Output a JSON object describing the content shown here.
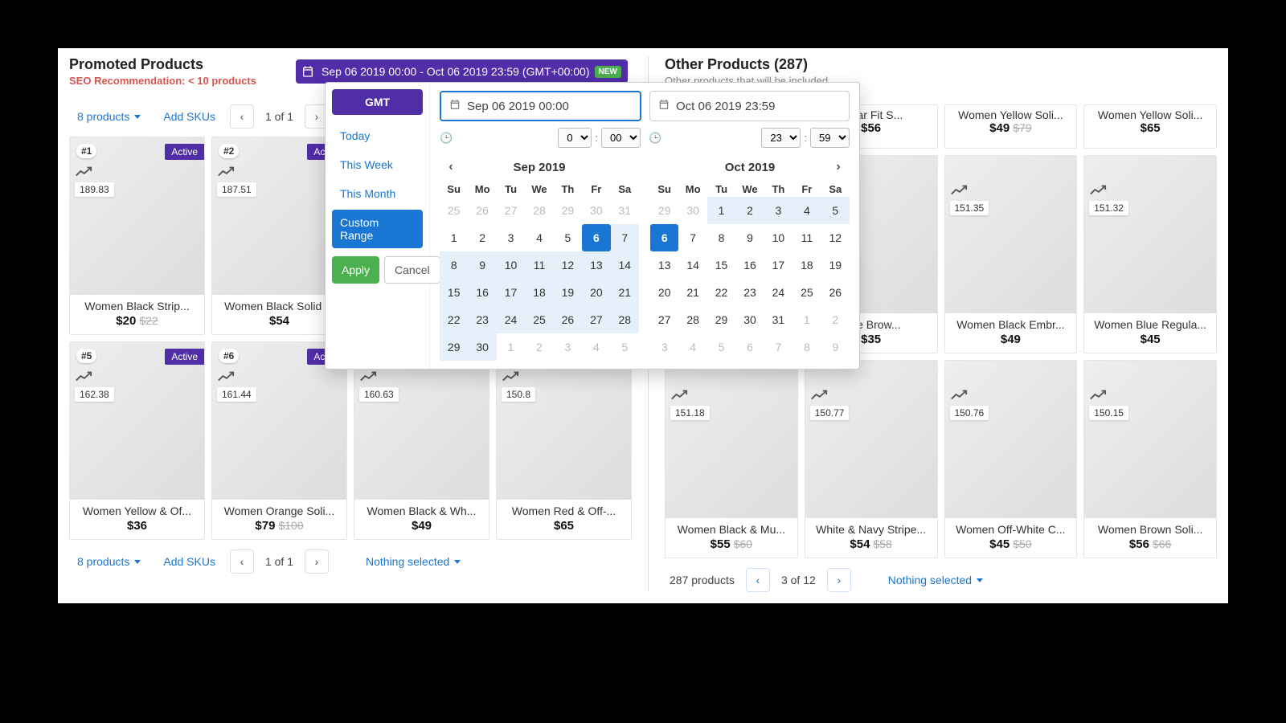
{
  "header": {
    "left_title": "Promoted Products",
    "left_sub": "SEO Recommendation: < 10 products",
    "right_title": "Other Products (287)",
    "right_sub": "Other products that will be included"
  },
  "datebar": {
    "text": "Sep 06 2019 00:00 - Oct 06 2019 23:59 (GMT+00:00)",
    "new": "NEW"
  },
  "toolbar_left": {
    "count": "8 products",
    "add": "Add SKUs",
    "page": "1 of 1"
  },
  "toolbar_right": {
    "count": "287 products",
    "page": "3 of 12",
    "nothing": "Nothing selected"
  },
  "footer_left": {
    "count": "8 products",
    "add": "Add SKUs",
    "page": "1 of 1",
    "nothing": "Nothing selected"
  },
  "popover": {
    "tz": "GMT",
    "presets": {
      "today": "Today",
      "week": "This Week",
      "month": "This Month",
      "custom": "Custom Range"
    },
    "apply": "Apply",
    "cancel": "Cancel",
    "start_input": "Sep 06 2019 00:00",
    "end_input": "Oct 06 2019 23:59",
    "start_hour": "0",
    "start_min": "00",
    "end_hour": "23",
    "end_min": "59",
    "month_left": "Sep 2019",
    "month_right": "Oct 2019",
    "dow": [
      "Su",
      "Mo",
      "Tu",
      "We",
      "Th",
      "Fr",
      "Sa"
    ]
  },
  "left_cards": [
    {
      "rank": "#1",
      "status": "Active",
      "score": "189.83",
      "title": "Women Black Strip...",
      "price": "$20",
      "old": "$22"
    },
    {
      "rank": "#2",
      "status": "Active",
      "score": "187.51",
      "title": "Women Black Solid ...",
      "price": "$54",
      "old": ""
    },
    {
      "rank": "",
      "status": "",
      "score": "",
      "title": "",
      "price": "",
      "old": ""
    },
    {
      "rank": "",
      "status": "",
      "score": "",
      "title": "",
      "price": "",
      "old": ""
    },
    {
      "rank": "#5",
      "status": "Active",
      "score": "162.38",
      "title": "Women Yellow & Of...",
      "price": "$36",
      "old": ""
    },
    {
      "rank": "#6",
      "status": "Active",
      "score": "161.44",
      "title": "Women Orange Soli...",
      "price": "$79",
      "old": "$100"
    },
    {
      "rank": "",
      "status": "",
      "score": "160.63",
      "title": "Women Black & Wh...",
      "price": "$49",
      "old": ""
    },
    {
      "rank": "",
      "status": "",
      "score": "150.8",
      "title": "Women Red & Off-...",
      "price": "$65",
      "old": ""
    }
  ],
  "right_top_mini": [
    {
      "title": "...ular Fit S...",
      "price": "$56",
      "old": ""
    },
    {
      "title": "Women Yellow Soli...",
      "price": "$49",
      "old": "$79"
    },
    {
      "title": "Women Yellow Soli...",
      "price": "$65",
      "old": ""
    }
  ],
  "right_cards": [
    {
      "score": "",
      "title": "...de Brow...",
      "price": "$35",
      "old": ""
    },
    {
      "score": "151.35",
      "title": "Women Black Embr...",
      "price": "$49",
      "old": ""
    },
    {
      "score": "151.32",
      "title": "Women Blue Regula...",
      "price": "$45",
      "old": ""
    },
    {
      "score": "151.18",
      "title": "Women Black & Mu...",
      "price": "$55",
      "old": "$60"
    },
    {
      "score": "150.77",
      "title": "White & Navy Stripe...",
      "price": "$54",
      "old": "$58"
    },
    {
      "score": "150.76",
      "title": "Women Off-White C...",
      "price": "$45",
      "old": "$50"
    },
    {
      "score": "150.15",
      "title": "Women Brown Soli...",
      "price": "$56",
      "old": "$66"
    }
  ]
}
